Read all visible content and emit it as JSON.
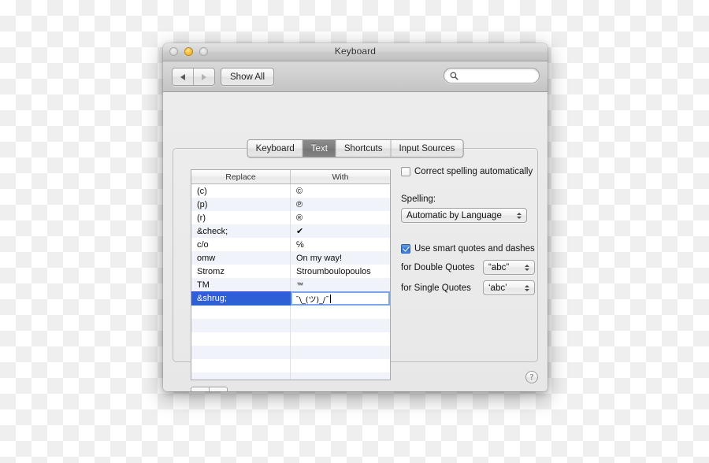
{
  "window": {
    "title": "Keyboard",
    "traffic_lights": [
      "close",
      "minimize",
      "zoom"
    ]
  },
  "toolbar": {
    "back_label": "back-arrow",
    "forward_label": "forward-arrow",
    "show_all_label": "Show All",
    "search": {
      "value": "",
      "placeholder": ""
    }
  },
  "tabs": [
    {
      "label": "Keyboard",
      "active": false
    },
    {
      "label": "Text",
      "active": true
    },
    {
      "label": "Shortcuts",
      "active": false
    },
    {
      "label": "Input Sources",
      "active": false
    }
  ],
  "table": {
    "columns": [
      "Replace",
      "With"
    ],
    "rows": [
      {
        "replace": "(c)",
        "with": "©",
        "selected": false,
        "editing": false
      },
      {
        "replace": "(p)",
        "with": "℗",
        "selected": false,
        "editing": false
      },
      {
        "replace": "(r)",
        "with": "®",
        "selected": false,
        "editing": false
      },
      {
        "replace": "&check;",
        "with": "✔",
        "selected": false,
        "editing": false
      },
      {
        "replace": "c/o",
        "with": "℅",
        "selected": false,
        "editing": false
      },
      {
        "replace": "omw",
        "with": "On my way!",
        "selected": false,
        "editing": false
      },
      {
        "replace": "Stromz",
        "with": "Stroumboulopoulos",
        "selected": false,
        "editing": false
      },
      {
        "replace": "TM",
        "with": "™",
        "selected": false,
        "editing": false
      },
      {
        "replace": "&shrug;",
        "with": "¯\\_(ツ)_/¯",
        "selected": true,
        "editing": true
      }
    ],
    "empty_row_count": 8,
    "selection_color": "#2e5fd4",
    "alt_row_color": "#f0f4fa"
  },
  "list_buttons": {
    "add_label": "+",
    "remove_label": "−"
  },
  "options": {
    "correct_spelling": {
      "label": "Correct spelling automatically",
      "checked": false
    },
    "spelling_section_label": "Spelling:",
    "spelling_value": "Automatic by Language",
    "smart_quotes": {
      "label": "Use smart quotes and dashes",
      "checked": true
    },
    "double_quotes_label": "for Double Quotes",
    "double_quotes_value": "“abc”",
    "single_quotes_label": "for Single Quotes",
    "single_quotes_value": "‘abc’"
  },
  "help": {
    "label": "?"
  }
}
